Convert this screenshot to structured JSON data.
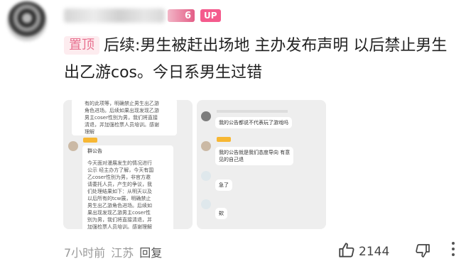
{
  "author": {
    "level": "6",
    "up_badge": "UP"
  },
  "comment": {
    "pin_label": "置顶",
    "text": "后续:男生被赶出场地 主办发布声明 以后禁止男生出乙游cos。今日系男生过错"
  },
  "screenshot1": {
    "top_lines": [
      "有的此项等，明确禁止男生出乙游",
      "角色进场。后续如果出现发现乙游",
      "男主coser性别为男，我们将直接",
      "清退，并加强检票人员培训。感谢",
      "理解"
    ],
    "announcement_title": "群公告",
    "announcement_lines": [
      "今天面对漫展发生的情况进行",
      "公示 经主办方了解，今天有国",
      "乙coser性别为男，非官方邀",
      "请委托人员，产生的争议，我",
      "们处理结果如下：从明天以及",
      "以后所有的tcw展，明确禁止",
      "男生出乙游角色进场。后续如",
      "果出现发现乙游男主coser性",
      "别为男，我们将直接清退，并",
      "加强检票人员培训。感谢理解"
    ]
  },
  "screenshot2": {
    "bubble1": "我的公告都说不代表玩了游戏吗",
    "bubble2": "我的公告就是我们态度导向 有意\n见的自己退",
    "bubble3": "急了",
    "bubble4": "欸"
  },
  "footer": {
    "time": "7小时前",
    "location": "江苏",
    "reply_label": "回复",
    "like_count": "2144"
  },
  "colors": {
    "accent_pink": "#f45b8d",
    "pin_text": "#e8708f",
    "muted_text": "#9a9a9a"
  }
}
